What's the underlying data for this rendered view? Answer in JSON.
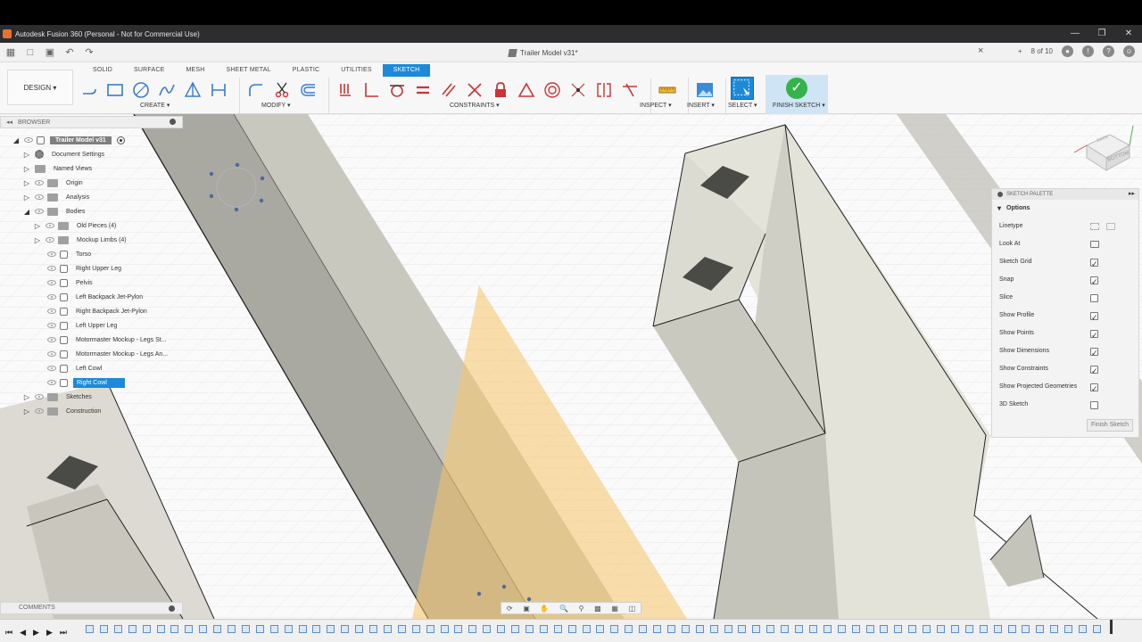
{
  "window": {
    "title": "Autodesk Fusion 360 (Personal - Not for Commercial Use)",
    "controls": [
      "—",
      "❐",
      "✕"
    ]
  },
  "document": {
    "tab_title": "Trailer Model v31*",
    "job_status": "8 of 10"
  },
  "ribbon": {
    "workspace": "DESIGN ▾",
    "tabs": [
      "SOLID",
      "SURFACE",
      "MESH",
      "SHEET METAL",
      "PLASTIC",
      "UTILITIES",
      "SKETCH"
    ],
    "active_tab": "SKETCH",
    "groups": {
      "create": "CREATE ▾",
      "modify": "MODIFY ▾",
      "constraints": "CONSTRAINTS ▾",
      "inspect": "INSPECT ▾",
      "insert": "INSERT ▾",
      "select": "SELECT ▾",
      "finish": "FINISH SKETCH ▾"
    }
  },
  "browser": {
    "title": "BROWSER",
    "root": "Trailer Model v31",
    "items": [
      {
        "label": "Document Settings"
      },
      {
        "label": "Named Views"
      },
      {
        "label": "Origin"
      },
      {
        "label": "Analysis"
      },
      {
        "label": "Bodies"
      },
      {
        "label": "Old Pieces (4)"
      },
      {
        "label": "Mockup Limbs (4)"
      },
      {
        "label": "Torso"
      },
      {
        "label": "Right Upper Leg"
      },
      {
        "label": "Pelvis"
      },
      {
        "label": "Left Backpack Jet-Pylon"
      },
      {
        "label": "Right Backpack Jet-Pylon"
      },
      {
        "label": "Left Upper Leg"
      },
      {
        "label": "Motormaster Mockup - Legs St..."
      },
      {
        "label": "Motormaster Mockup - Legs An..."
      },
      {
        "label": "Left Cowl"
      },
      {
        "label": "Right Cowl"
      },
      {
        "label": "Sketches"
      },
      {
        "label": "Construction"
      }
    ]
  },
  "sketch_palette": {
    "title": "SKETCH PALETTE",
    "section": "Options",
    "options": [
      {
        "label": "Linetype"
      },
      {
        "label": "Look At"
      },
      {
        "label": "Sketch Grid",
        "checked": true
      },
      {
        "label": "Snap",
        "checked": true
      },
      {
        "label": "Slice",
        "checked": false
      },
      {
        "label": "Show Profile",
        "checked": true
      },
      {
        "label": "Show Points",
        "checked": true
      },
      {
        "label": "Show Dimensions",
        "checked": true
      },
      {
        "label": "Show Constraints",
        "checked": true
      },
      {
        "label": "Show Projected Geometries",
        "checked": true
      },
      {
        "label": "3D Sketch",
        "checked": false
      }
    ],
    "finish_button": "Finish Sketch"
  },
  "viewcube": {
    "face": "BOTTOM",
    "face2": "BACK"
  },
  "comments": {
    "title": "COMMENTS"
  },
  "colors": {
    "accent": "#1c8ad8",
    "finish_green": "#35b34a",
    "plane_orange": "#f5c46a"
  }
}
